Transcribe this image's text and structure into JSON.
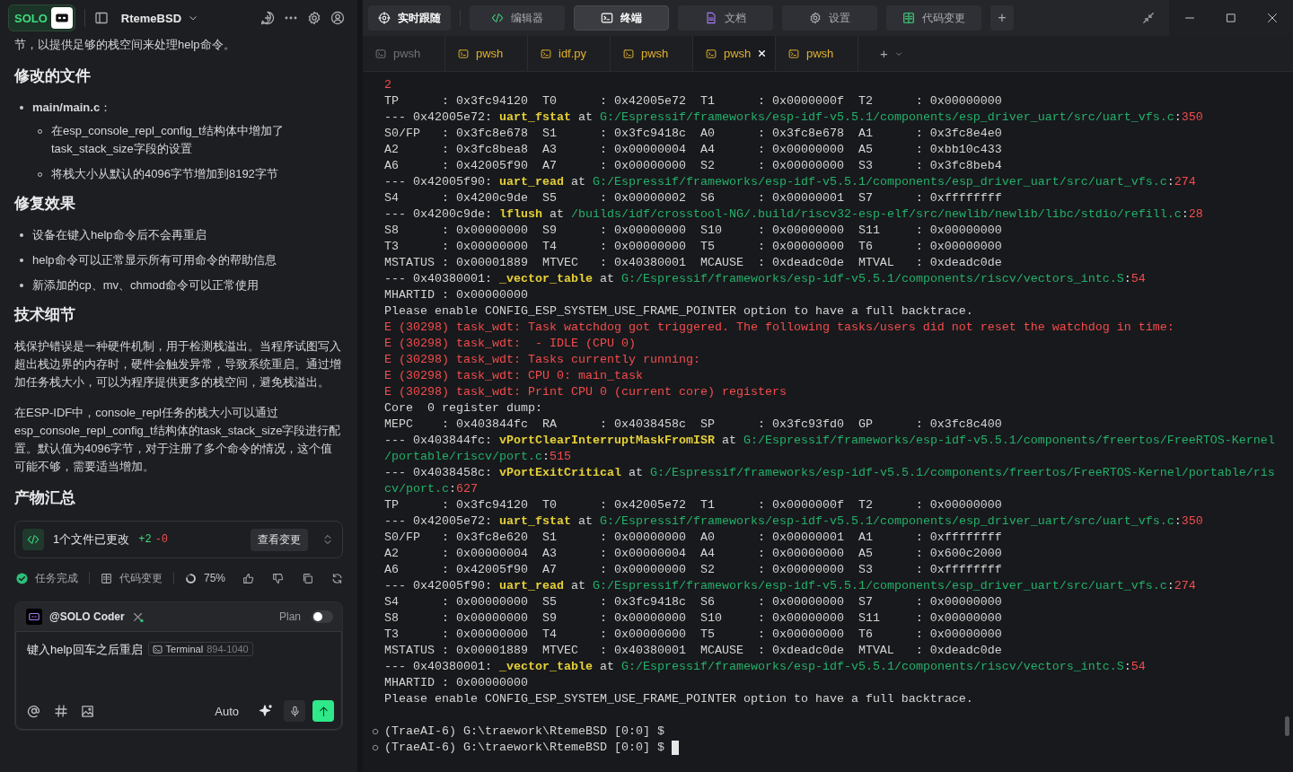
{
  "left_panel": {
    "logo": "SOLO",
    "project": "RtemeBSD",
    "content": [
      {
        "kind": "paragraph",
        "text": "节，以提供足够的栈空间来处理help命令。"
      },
      {
        "kind": "heading",
        "text": "修改的文件"
      },
      {
        "kind": "bullets",
        "items": [
          {
            "text": "**main/main.c**：",
            "children": [
              {
                "text": "在esp_console_repl_config_t结构体中增加了task_stack_size字段的设置"
              },
              {
                "text": "将栈大小从默认的4096字节增加到8192字节"
              }
            ]
          }
        ]
      },
      {
        "kind": "heading",
        "text": "修复效果"
      },
      {
        "kind": "bullets",
        "items": [
          {
            "text": "设备在键入help命令后不会再重启"
          },
          {
            "text": "help命令可以正常显示所有可用命令的帮助信息"
          },
          {
            "text": "新添加的cp、mv、chmod命令可以正常使用"
          }
        ]
      },
      {
        "kind": "heading",
        "text": "技术细节"
      },
      {
        "kind": "paragraph",
        "text": "栈保护错误是一种硬件机制，用于检测栈溢出。当程序试图写入超出栈边界的内存时，硬件会触发异常，导致系统重启。通过增加任务栈大小，可以为程序提供更多的栈空间，避免栈溢出。"
      },
      {
        "kind": "paragraph",
        "text": "在ESP-IDF中，console_repl任务的栈大小可以通过esp_console_repl_config_t结构体的task_stack_size字段进行配置。默认值为4096字节，对于注册了多个命令的情况，这个值可能不够，需要适当增加。"
      },
      {
        "kind": "heading",
        "text": "产物汇总"
      }
    ],
    "changes_card": {
      "summary": "1个文件已更改",
      "added": "+2",
      "removed": "-0",
      "button": "查看变更"
    },
    "status": {
      "task": "任务完成",
      "changes": "代码变更",
      "progress": "75%"
    },
    "composer": {
      "agent": "@SOLO Coder",
      "plan_label": "Plan",
      "plan_on": false,
      "message": "键入help回车之后重启",
      "chip": {
        "label": "Terminal",
        "range": "894-1040"
      },
      "mode": "Auto"
    }
  },
  "top_bar": {
    "follow_button": "实时跟随",
    "tabs": [
      {
        "label": "编辑器",
        "kind": "code",
        "selected": false
      },
      {
        "label": "终端",
        "kind": "terminal",
        "selected": true
      },
      {
        "label": "文档",
        "kind": "doc",
        "selected": false
      },
      {
        "label": "设置",
        "kind": "settings",
        "selected": false
      },
      {
        "label": "代码变更",
        "kind": "diff",
        "selected": false
      }
    ],
    "add": "+"
  },
  "terminal_tabs": [
    {
      "label": "pwsh",
      "active": false,
      "selected": false
    },
    {
      "label": "pwsh",
      "active": true,
      "selected": false
    },
    {
      "label": "idf.py",
      "active": true,
      "selected": false
    },
    {
      "label": "pwsh",
      "active": true,
      "selected": false
    },
    {
      "label": "pwsh",
      "active": true,
      "selected": true
    },
    {
      "label": "pwsh",
      "active": true,
      "selected": false
    }
  ],
  "terminal_add": "+",
  "terminal": {
    "lines": [
      [
        {
          "kind": "error",
          "text": "2"
        }
      ],
      [
        {
          "kind": "text",
          "text": "TP      : 0x3fc94120  T0      : 0x42005e72  T1      : 0x0000000f  T2      : 0x00000000"
        }
      ],
      [
        {
          "kind": "text",
          "text": "--- 0x42005e72: "
        },
        {
          "kind": "func",
          "text": "uart_fstat"
        },
        {
          "kind": "text",
          "text": " at "
        },
        {
          "kind": "path",
          "text": "G:/Espressif/frameworks/esp-idf-v5.5.1/components/esp_driver_uart/src/uart_vfs.c"
        },
        {
          "kind": "text",
          "text": ":"
        },
        {
          "kind": "lineno",
          "text": "350"
        }
      ],
      [
        {
          "kind": "text",
          "text": "S0/FP   : 0x3fc8e678  S1      : 0x3fc9418c  A0      : 0x3fc8e678  A1      : 0x3fc8e4e0"
        }
      ],
      [
        {
          "kind": "text",
          "text": "A2      : 0x3fc8bea8  A3      : 0x00000004  A4      : 0x00000000  A5      : 0xbb10c433"
        }
      ],
      [
        {
          "kind": "text",
          "text": "A6      : 0x42005f90  A7      : 0x00000000  S2      : 0x00000000  S3      : 0x3fc8beb4"
        }
      ],
      [
        {
          "kind": "text",
          "text": "--- 0x42005f90: "
        },
        {
          "kind": "func",
          "text": "uart_read"
        },
        {
          "kind": "text",
          "text": " at "
        },
        {
          "kind": "path",
          "text": "G:/Espressif/frameworks/esp-idf-v5.5.1/components/esp_driver_uart/src/uart_vfs.c"
        },
        {
          "kind": "text",
          "text": ":"
        },
        {
          "kind": "lineno",
          "text": "274"
        }
      ],
      [
        {
          "kind": "text",
          "text": "S4      : 0x4200c9de  S5      : 0x00000002  S6      : 0x00000001  S7      : 0xffffffff"
        }
      ],
      [
        {
          "kind": "text",
          "text": "--- 0x4200c9de: "
        },
        {
          "kind": "func",
          "text": "lflush"
        },
        {
          "kind": "text",
          "text": " at "
        },
        {
          "kind": "path",
          "text": "/builds/idf/crosstool-NG/.build/riscv32-esp-elf/src/newlib/newlib/libc/stdio/refill.c"
        },
        {
          "kind": "text",
          "text": ":"
        },
        {
          "kind": "lineno",
          "text": "28"
        }
      ],
      [
        {
          "kind": "text",
          "text": "S8      : 0x00000000  S9      : 0x00000000  S10     : 0x00000000  S11     : 0x00000000"
        }
      ],
      [
        {
          "kind": "text",
          "text": "T3      : 0x00000000  T4      : 0x00000000  T5      : 0x00000000  T6      : 0x00000000"
        }
      ],
      [
        {
          "kind": "text",
          "text": "MSTATUS : 0x00001889  MTVEC   : 0x40380001  MCAUSE  : 0xdeadc0de  MTVAL   : 0xdeadc0de"
        }
      ],
      [
        {
          "kind": "text",
          "text": "--- 0x40380001: "
        },
        {
          "kind": "func",
          "text": "_vector_table"
        },
        {
          "kind": "text",
          "text": " at "
        },
        {
          "kind": "path",
          "text": "G:/Espressif/frameworks/esp-idf-v5.5.1/components/riscv/vectors_intc.S"
        },
        {
          "kind": "text",
          "text": ":"
        },
        {
          "kind": "lineno",
          "text": "54"
        }
      ],
      [
        {
          "kind": "text",
          "text": "MHARTID : 0x00000000"
        }
      ],
      [
        {
          "kind": "text",
          "text": "Please enable CONFIG_ESP_SYSTEM_USE_FRAME_POINTER option to have a full backtrace."
        }
      ],
      [
        {
          "kind": "error",
          "text": "E (30298) task_wdt: Task watchdog got triggered. The following tasks/users did not reset the watchdog in time:"
        }
      ],
      [
        {
          "kind": "error",
          "text": "E (30298) task_wdt:  - IDLE (CPU 0)"
        }
      ],
      [
        {
          "kind": "error",
          "text": "E (30298) task_wdt: Tasks currently running:"
        }
      ],
      [
        {
          "kind": "error",
          "text": "E (30298) task_wdt: CPU 0: main_task"
        }
      ],
      [
        {
          "kind": "error",
          "text": "E (30298) task_wdt: Print CPU 0 (current core) registers"
        }
      ],
      [
        {
          "kind": "text",
          "text": "Core  0 register dump:"
        }
      ],
      [
        {
          "kind": "text",
          "text": "MEPC    : 0x403844fc  RA      : 0x4038458c  SP      : 0x3fc93fd0  GP      : 0x3fc8c400"
        }
      ],
      [
        {
          "kind": "text",
          "text": "--- 0x403844fc: "
        },
        {
          "kind": "func",
          "text": "vPortClearInterruptMaskFromISR"
        },
        {
          "kind": "text",
          "text": " at "
        },
        {
          "kind": "path",
          "text": "G:/Espressif/frameworks/esp-idf-v5.5.1/components/freertos/FreeRTOS-Kernel"
        }
      ],
      [
        {
          "kind": "path",
          "text": "/portable/riscv/port.c"
        },
        {
          "kind": "text",
          "text": ":"
        },
        {
          "kind": "lineno",
          "text": "515"
        }
      ],
      [
        {
          "kind": "text",
          "text": "--- 0x4038458c: "
        },
        {
          "kind": "func",
          "text": "vPortExitCritical"
        },
        {
          "kind": "text",
          "text": " at "
        },
        {
          "kind": "path",
          "text": "G:/Espressif/frameworks/esp-idf-v5.5.1/components/freertos/FreeRTOS-Kernel/portable/ris"
        }
      ],
      [
        {
          "kind": "path",
          "text": "cv/port.c"
        },
        {
          "kind": "text",
          "text": ":"
        },
        {
          "kind": "lineno",
          "text": "627"
        }
      ],
      [
        {
          "kind": "text",
          "text": "TP      : 0x3fc94120  T0      : 0x42005e72  T1      : 0x0000000f  T2      : 0x00000000"
        }
      ],
      [
        {
          "kind": "text",
          "text": "--- 0x42005e72: "
        },
        {
          "kind": "func",
          "text": "uart_fstat"
        },
        {
          "kind": "text",
          "text": " at "
        },
        {
          "kind": "path",
          "text": "G:/Espressif/frameworks/esp-idf-v5.5.1/components/esp_driver_uart/src/uart_vfs.c"
        },
        {
          "kind": "text",
          "text": ":"
        },
        {
          "kind": "lineno",
          "text": "350"
        }
      ],
      [
        {
          "kind": "text",
          "text": "S0/FP   : 0x3fc8e620  S1      : 0x00000000  A0      : 0x00000001  A1      : 0xffffffff"
        }
      ],
      [
        {
          "kind": "text",
          "text": "A2      : 0x00000004  A3      : 0x00000004  A4      : 0x00000000  A5      : 0x600c2000"
        }
      ],
      [
        {
          "kind": "text",
          "text": "A6      : 0x42005f90  A7      : 0x00000000  S2      : 0x00000000  S3      : 0xffffffff"
        }
      ],
      [
        {
          "kind": "text",
          "text": "--- 0x42005f90: "
        },
        {
          "kind": "func",
          "text": "uart_read"
        },
        {
          "kind": "text",
          "text": " at "
        },
        {
          "kind": "path",
          "text": "G:/Espressif/frameworks/esp-idf-v5.5.1/components/esp_driver_uart/src/uart_vfs.c"
        },
        {
          "kind": "text",
          "text": ":"
        },
        {
          "kind": "lineno",
          "text": "274"
        }
      ],
      [
        {
          "kind": "text",
          "text": "S4      : 0x00000000  S5      : 0x3fc9418c  S6      : 0x00000000  S7      : 0x00000000"
        }
      ],
      [
        {
          "kind": "text",
          "text": "S8      : 0x00000000  S9      : 0x00000000  S10     : 0x00000000  S11     : 0x00000000"
        }
      ],
      [
        {
          "kind": "text",
          "text": "T3      : 0x00000000  T4      : 0x00000000  T5      : 0x00000000  T6      : 0x00000000"
        }
      ],
      [
        {
          "kind": "text",
          "text": "MSTATUS : 0x00001889  MTVEC   : 0x40380001  MCAUSE  : 0xdeadc0de  MTVAL   : 0xdeadc0de"
        }
      ],
      [
        {
          "kind": "text",
          "text": "--- 0x40380001: "
        },
        {
          "kind": "func",
          "text": "_vector_table"
        },
        {
          "kind": "text",
          "text": " at "
        },
        {
          "kind": "path",
          "text": "G:/Espressif/frameworks/esp-idf-v5.5.1/components/riscv/vectors_intc.S"
        },
        {
          "kind": "text",
          "text": ":"
        },
        {
          "kind": "lineno",
          "text": "54"
        }
      ],
      [
        {
          "kind": "text",
          "text": "MHARTID : 0x00000000"
        }
      ],
      [
        {
          "kind": "text",
          "text": "Please enable CONFIG_ESP_SYSTEM_USE_FRAME_POINTER option to have a full backtrace."
        }
      ]
    ],
    "prompts": [
      {
        "text": "(TraeAI-6) G:\\traework\\RtemeBSD [0:0] $",
        "cursor": false
      },
      {
        "text": "(TraeAI-6) G:\\traework\\RtemeBSD [0:0] $",
        "cursor": true
      }
    ]
  }
}
